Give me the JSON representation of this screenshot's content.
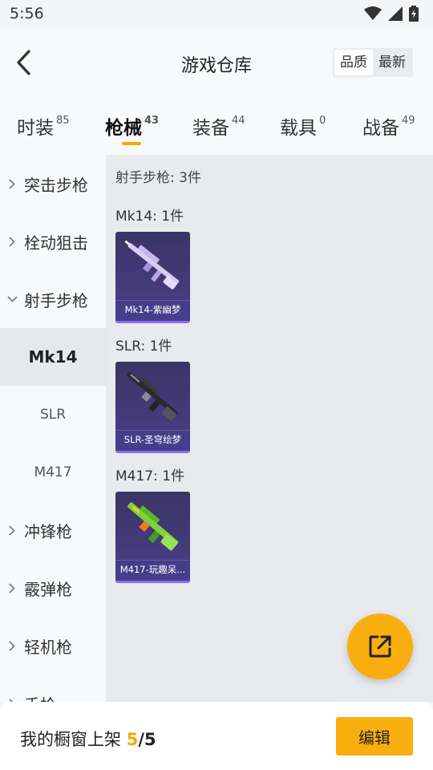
{
  "status_bar": {
    "time": "5:56"
  },
  "header": {
    "title": "游戏仓库",
    "sort_options": [
      "品质",
      "最新"
    ]
  },
  "tabs": [
    {
      "label": "时装",
      "count": "85"
    },
    {
      "label": "枪械",
      "count": "43"
    },
    {
      "label": "装备",
      "count": "44"
    },
    {
      "label": "载具",
      "count": "0"
    },
    {
      "label": "战备",
      "count": "49"
    }
  ],
  "sidebar": {
    "categories": [
      "突击步枪",
      "栓动狙击",
      "射手步枪",
      "冲锋枪",
      "霰弹枪",
      "轻机枪",
      "手枪"
    ],
    "subitems": [
      "Mk14",
      "SLR",
      "M417"
    ]
  },
  "content": {
    "summary": "射手步枪: 3件",
    "groups": [
      {
        "title": "Mk14: 1件",
        "item_label": "Mk14-紫幽梦"
      },
      {
        "title": "SLR: 1件",
        "item_label": "SLR-圣穹绘梦"
      },
      {
        "title": "M417: 1件",
        "item_label": "M417-玩趣呆..."
      }
    ]
  },
  "bottom_bar": {
    "showcase_label": "我的橱窗上架",
    "showcase_count": "5",
    "showcase_sep": "/",
    "showcase_total": "5",
    "edit_label": "编辑"
  },
  "colors": {
    "accent": "#f9ae0f",
    "card_bg": "#433a78"
  },
  "icons": [
    "back-arrow-icon",
    "wifi-icon",
    "signal-icon",
    "battery-icon",
    "chevron-right-icon",
    "chevron-down-icon",
    "share-external-icon"
  ]
}
